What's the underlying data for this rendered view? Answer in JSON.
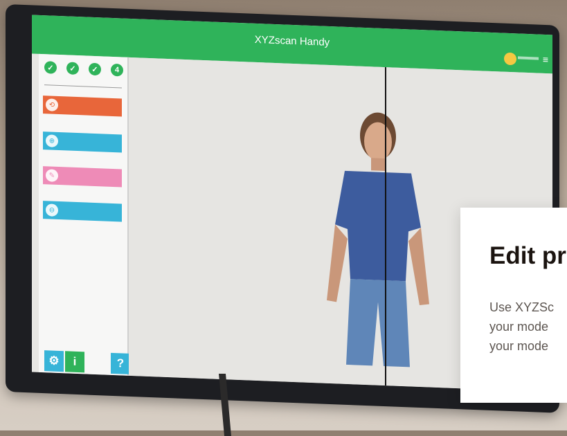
{
  "app": {
    "title": "XYZscan Handy"
  },
  "header": {
    "user_icon": "user-avatar-icon",
    "menu_icon": "hamburger-menu-icon"
  },
  "sidebar": {
    "steps": [
      "✓",
      "✓",
      "✓",
      "4"
    ],
    "actions": [
      {
        "icon": "scan-icon",
        "glyph": "⟲"
      },
      {
        "icon": "import-icon",
        "glyph": "⊕"
      },
      {
        "icon": "edit-icon",
        "glyph": "✎"
      },
      {
        "icon": "view-icon",
        "glyph": "⊖"
      }
    ],
    "bottom": {
      "settings_glyph": "⚙",
      "info_glyph": "i",
      "help_glyph": "?"
    }
  },
  "overlay": {
    "title": "Edit pr",
    "lines": [
      "Use XYZSc",
      "your mode",
      "your mode"
    ]
  },
  "colors": {
    "topbar": "#2fb35a",
    "scan": "#e8663a",
    "import": "#37b4d8",
    "edit": "#ee8bb7",
    "view": "#37b4d8"
  }
}
